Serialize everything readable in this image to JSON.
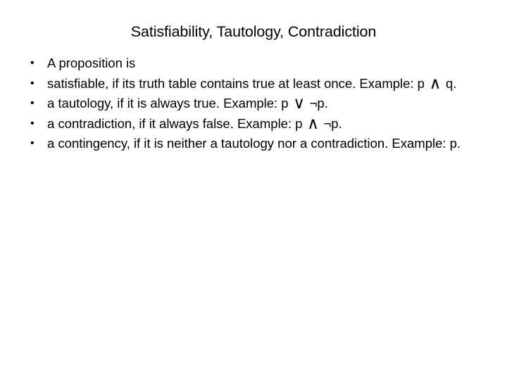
{
  "slide": {
    "title": "Satisfiability, Tautology, Contradiction",
    "bullet_marker": "•",
    "bullets": [
      {
        "id": "proposition-intro",
        "text": "A proposition is"
      },
      {
        "id": "satisfiable",
        "text": "satisfiable, if its truth table contains true at least once. Example: p ∧ q."
      },
      {
        "id": "tautology",
        "text": "a tautology, if it is always true. Example: p ∨ ¬p."
      },
      {
        "id": "contradiction",
        "text": "a contradiction, if it always false. Example: p ∧ ¬p."
      },
      {
        "id": "contingency",
        "text": "a contingency, if it is neither a tautology nor a contradiction. Example: p."
      }
    ],
    "symbols": {
      "conjunction": "∧",
      "disjunction": "∨",
      "negation": "¬"
    },
    "colors": {
      "background": "#ffffff",
      "text": "#000000"
    }
  }
}
